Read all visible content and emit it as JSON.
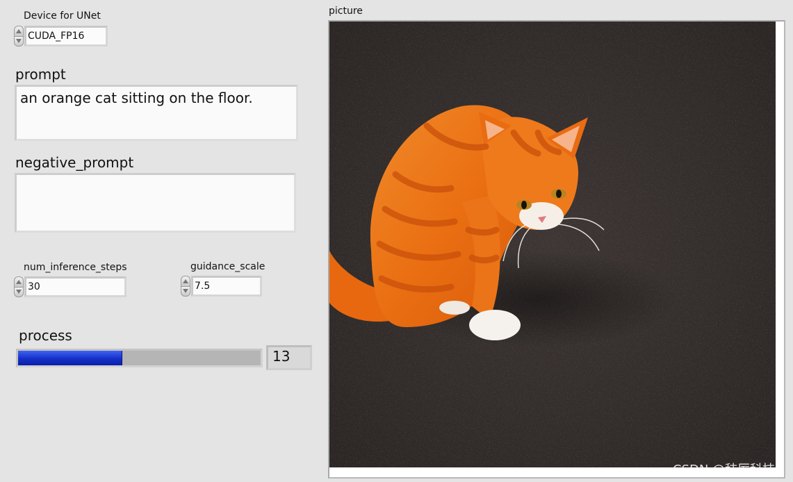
{
  "device": {
    "label": "Device for UNet",
    "value": "CUDA_FP16"
  },
  "prompt": {
    "label": "prompt",
    "value": "an orange cat sitting on the floor."
  },
  "negative_prompt": {
    "label": "negative_prompt",
    "value": ""
  },
  "num_inference_steps": {
    "label": "num_inference_steps",
    "value": "30"
  },
  "guidance_scale": {
    "label": "guidance_scale",
    "value": "7.5"
  },
  "process": {
    "label": "process",
    "value": "13",
    "fraction": 0.43,
    "fill_color": "#1430c8"
  },
  "picture": {
    "label": "picture",
    "subject": "orange tabby cat sitting on dark asphalt",
    "watermark": "CSDN @秣厉科技"
  },
  "colors": {
    "panel_background": "#e4e4e4",
    "progress_track": "#b5b5b5",
    "progress_fill": "#1430c8"
  },
  "icons": [
    "increment-arrow-icon",
    "decrement-arrow-icon"
  ]
}
